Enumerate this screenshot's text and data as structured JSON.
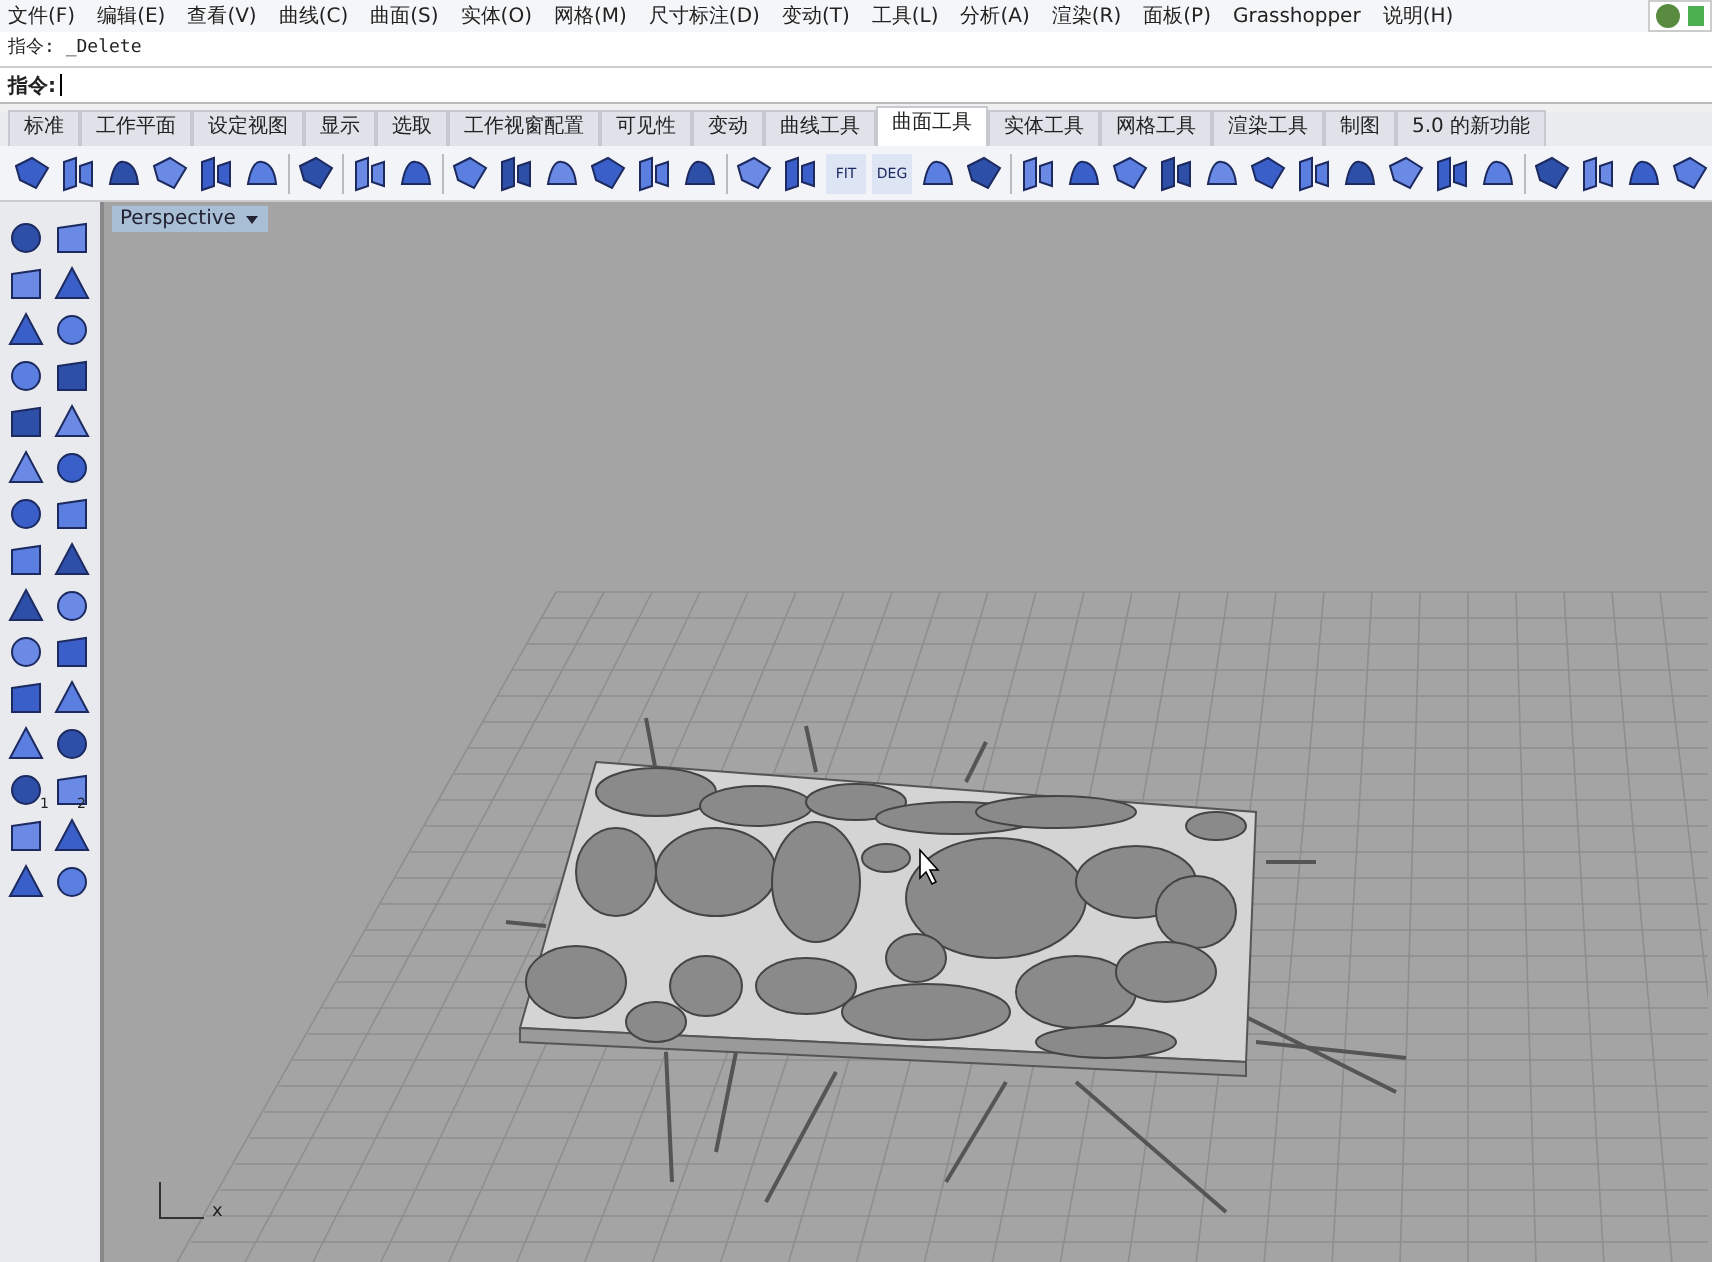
{
  "menu_bar": {
    "items": [
      "文件(F)",
      "编辑(E)",
      "查看(V)",
      "曲线(C)",
      "曲面(S)",
      "实体(O)",
      "网格(M)",
      "尺寸标注(D)",
      "变动(T)",
      "工具(L)",
      "分析(A)",
      "渲染(R)",
      "面板(P)",
      "Grasshopper",
      "说明(H)"
    ]
  },
  "command_history": {
    "prompt": "指令:",
    "text": "_Delete"
  },
  "command_line": {
    "prompt": "指令:"
  },
  "tabs": [
    {
      "label": "标准",
      "selected": false
    },
    {
      "label": "工作平面",
      "selected": false
    },
    {
      "label": "设定视图",
      "selected": false
    },
    {
      "label": "显示",
      "selected": false
    },
    {
      "label": "选取",
      "selected": false
    },
    {
      "label": "工作视窗配置",
      "selected": false
    },
    {
      "label": "可见性",
      "selected": false
    },
    {
      "label": "变动",
      "selected": false
    },
    {
      "label": "曲线工具",
      "selected": false
    },
    {
      "label": "曲面工具",
      "selected": true
    },
    {
      "label": "实体工具",
      "selected": false
    },
    {
      "label": "网格工具",
      "selected": false
    },
    {
      "label": "渲染工具",
      "selected": false
    },
    {
      "label": "制图",
      "selected": false
    },
    {
      "label": "5.0 的新功能",
      "selected": false
    }
  ],
  "toolbar": {
    "text_buttons": [
      "FIT",
      "DEG"
    ]
  },
  "left_toolbar": {
    "numbers": [
      "1",
      "2"
    ]
  },
  "viewport": {
    "title": "Perspective",
    "axis_label": "x"
  }
}
